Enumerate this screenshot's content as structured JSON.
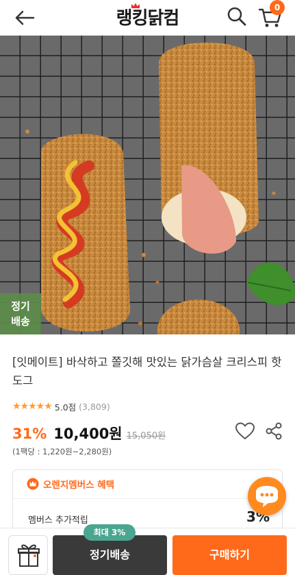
{
  "header": {
    "logo_text": "랭킹닭컴",
    "cart_count": "0",
    "icons": [
      "back-arrow-icon",
      "search-icon",
      "cart-icon"
    ]
  },
  "hero": {
    "badge_line1": "정기",
    "badge_line2": "배송"
  },
  "product": {
    "title": "[잇메이트] 바삭하고 쫄깃해 맛있는 닭가슴살 크리스피 핫도그",
    "stars": "★★★★★",
    "rating_score": "5.0점",
    "rating_count": "(3,809)",
    "discount": "31%",
    "price": "10,400원",
    "original_price": "15,050원",
    "unit_price": "(1팩당 : 1,220원~2,280원)"
  },
  "member": {
    "heading": "오렌지멤버스 혜택",
    "label": "멤버스 추가적립",
    "value": "3%"
  },
  "bottom": {
    "max_chip": "최대 3%",
    "subscribe_label": "정기배송",
    "buy_label": "구매하기"
  },
  "colors": {
    "accent": "#ff6a1a",
    "subscription_green": "#4aa690",
    "dark_button": "#3a3a3a",
    "star": "#ff9d2b"
  }
}
